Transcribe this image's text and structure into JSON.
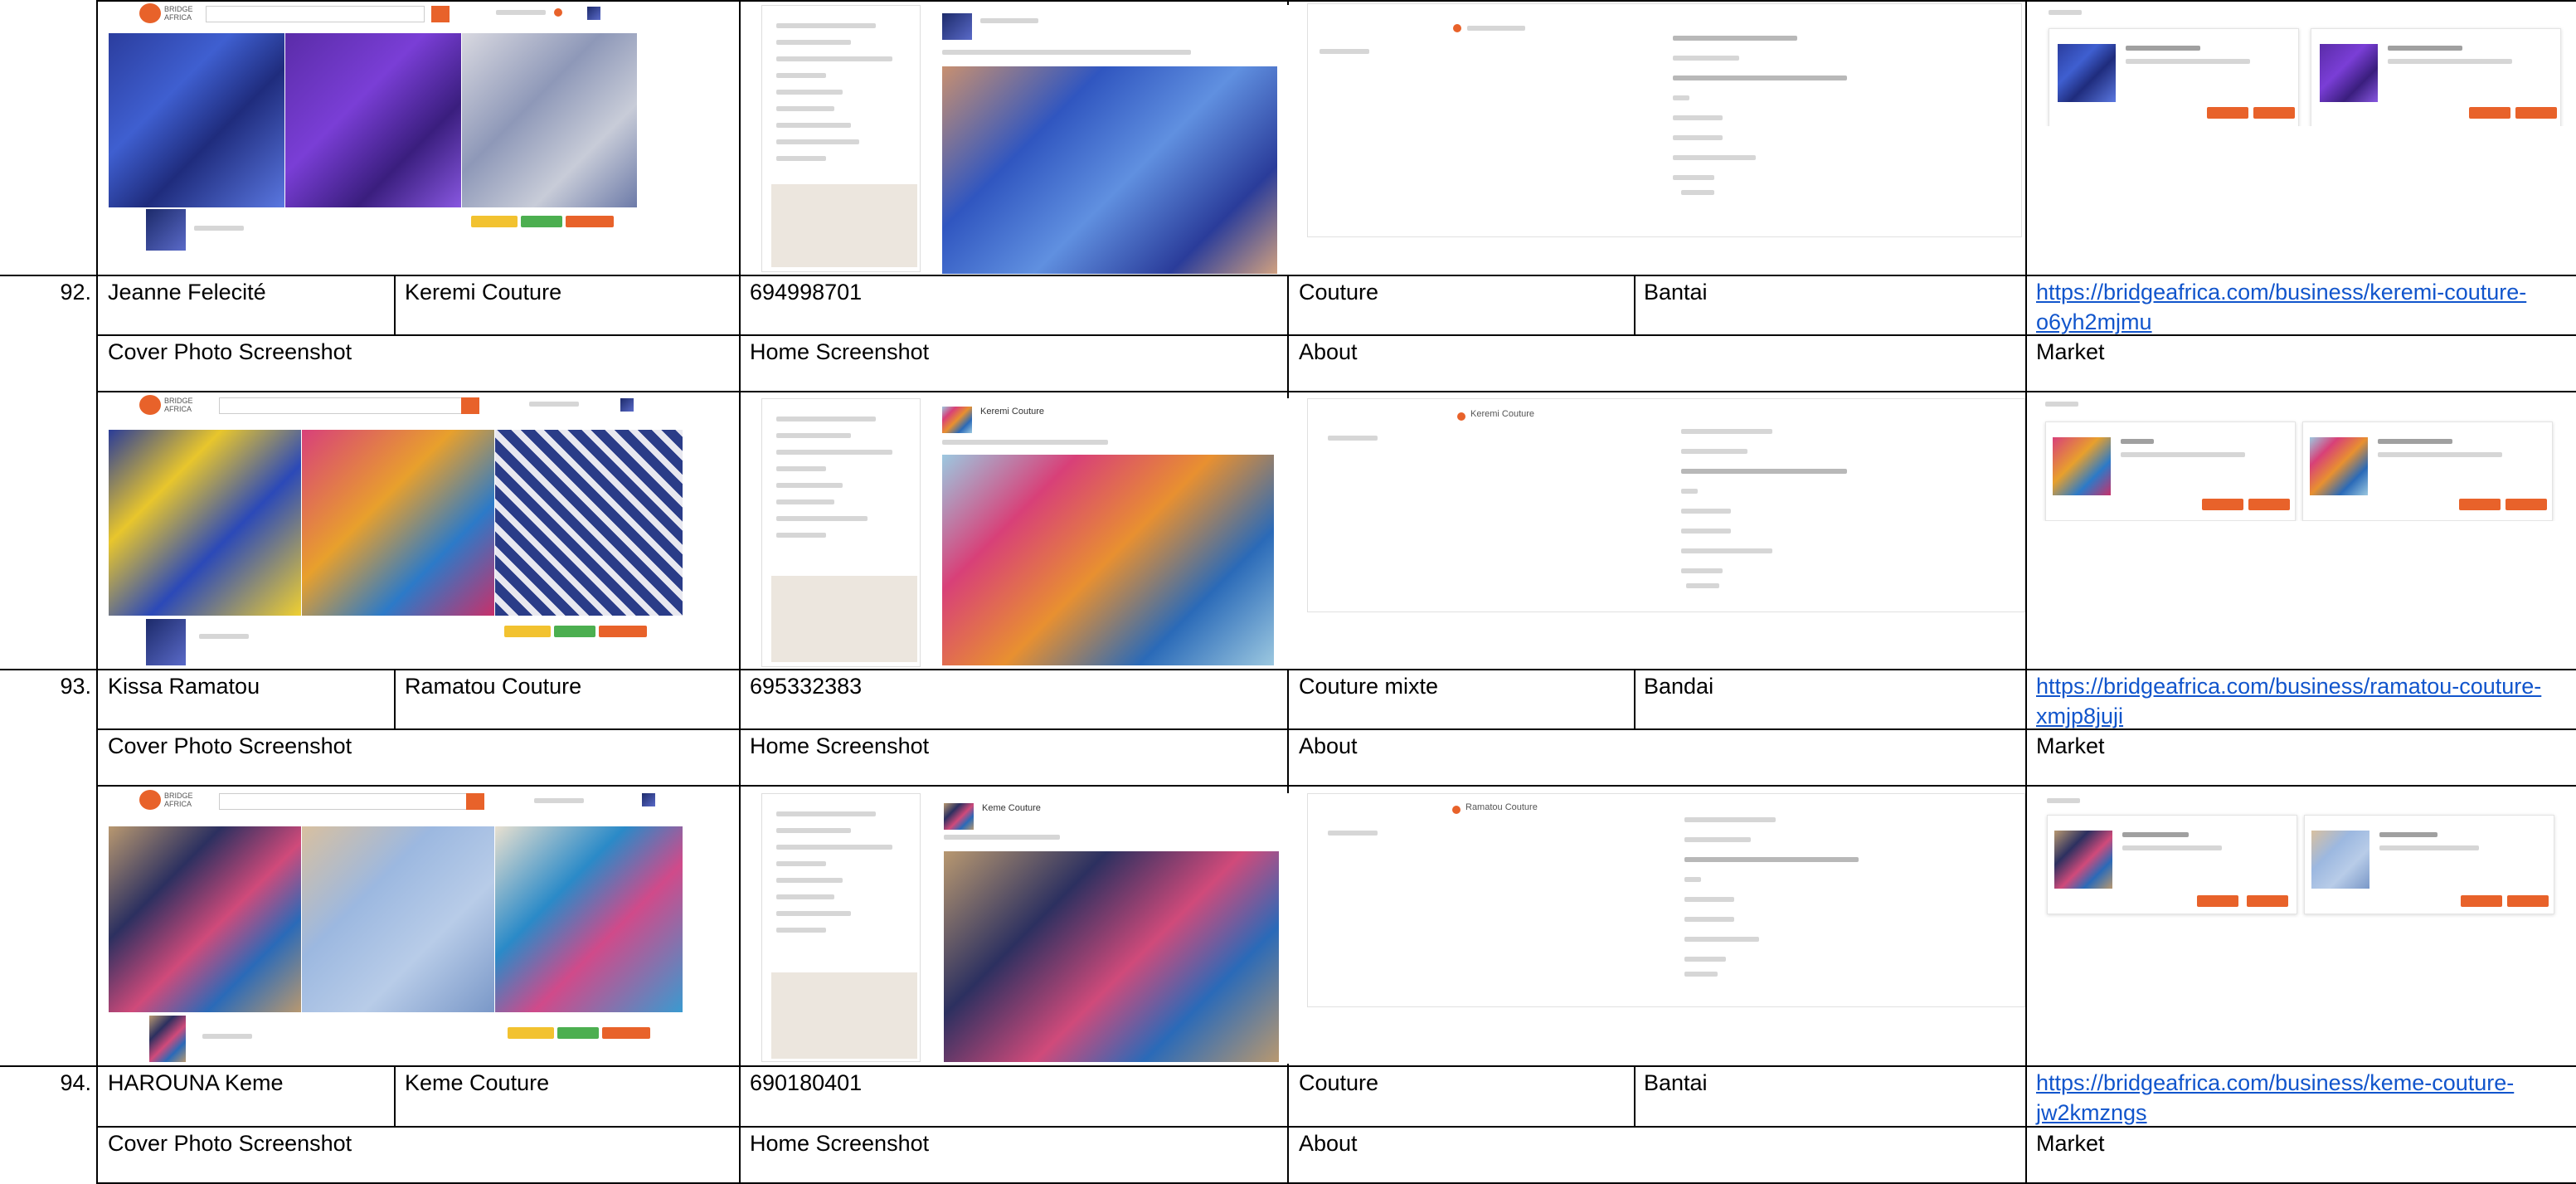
{
  "headers": {
    "cover": "Cover Photo Screenshot",
    "home": "Home Screenshot",
    "about": "About",
    "market": "Market"
  },
  "rows": [
    {
      "number": "92.",
      "owner": "Jeanne Felecité",
      "business": "Keremi Couture",
      "phone": "694998701",
      "category": "Couture",
      "location": "Bantai",
      "link": "https://bridgeafrica.com/business/keremi-couture-o6yh2mjmu"
    },
    {
      "number": "93.",
      "owner": "Kissa Ramatou",
      "business": "Ramatou Couture",
      "phone": "695332383",
      "category": "Couture mixte",
      "location": "Bandai",
      "link": "https://bridgeafrica.com/business/ramatou-couture-xmjp8juji"
    },
    {
      "number": "94.",
      "owner": "HAROUNA Keme",
      "business": "Keme Couture",
      "phone": "690180401",
      "category": "Couture",
      "location": "Bantai",
      "link": "https://bridgeafrica.com/business/keme-couture-jw2kmzngs"
    }
  ],
  "screenshots": {
    "brand": "BRIDGE AFRICA",
    "about_name_1": "Keremi Couture",
    "about_name_2": "Ramatou Couture",
    "home_title_1": "Keremi Couture",
    "home_title_2": "Keme Couture"
  },
  "colors": {
    "accent": "#e8622a",
    "link": "#1155cc",
    "border": "#000000"
  }
}
